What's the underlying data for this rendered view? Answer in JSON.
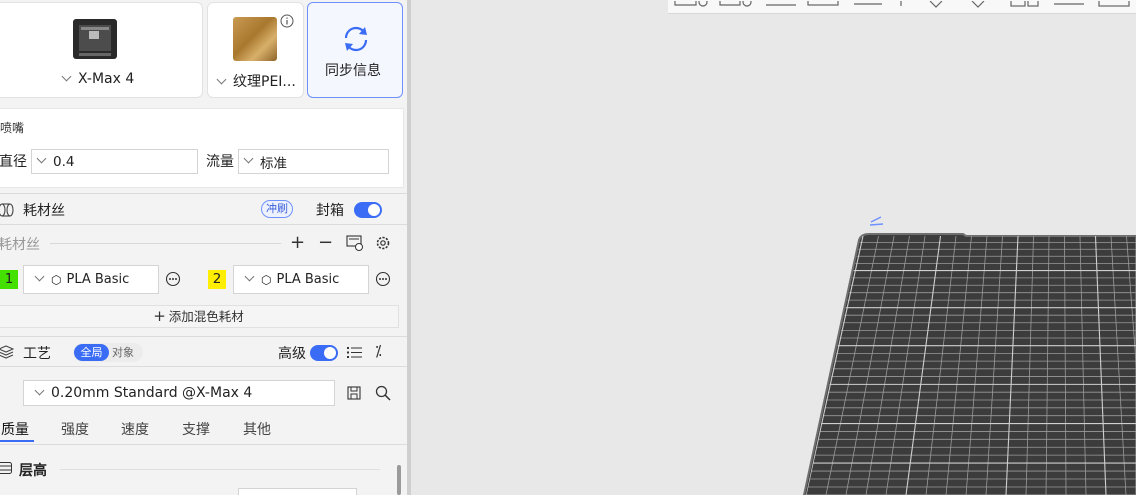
{
  "printer": {
    "name": "X-Max 4"
  },
  "plate": {
    "name": "纹理PEI..."
  },
  "sync": {
    "label": "同步信息"
  },
  "nozzle": {
    "title": "喷嘴",
    "diameter_label": "直径",
    "diameter_value": "0.4",
    "flow_label": "流量",
    "flow_value": "标准"
  },
  "filament_section": {
    "title": "耗材丝",
    "flush_label": "冲刷",
    "enclosure_label": "封箱",
    "sub_title": "耗材丝",
    "slots": [
      {
        "num": "1",
        "material": "PLA Basic",
        "color": "#44e000"
      },
      {
        "num": "2",
        "material": "PLA Basic",
        "color": "#ffee00"
      }
    ],
    "add_mix_label": "添加混色耗材"
  },
  "process_section": {
    "title": "工艺",
    "scope_global": "全局",
    "scope_object": "对象",
    "advanced_label": "高级",
    "preset": "0.20mm Standard @X-Max 4",
    "tabs": [
      "质量",
      "强度",
      "速度",
      "支撑",
      "其他"
    ],
    "group_title": "层高"
  },
  "colors": {
    "accent": "#3a6cf5",
    "bed_grid": "#4a4a4a"
  }
}
